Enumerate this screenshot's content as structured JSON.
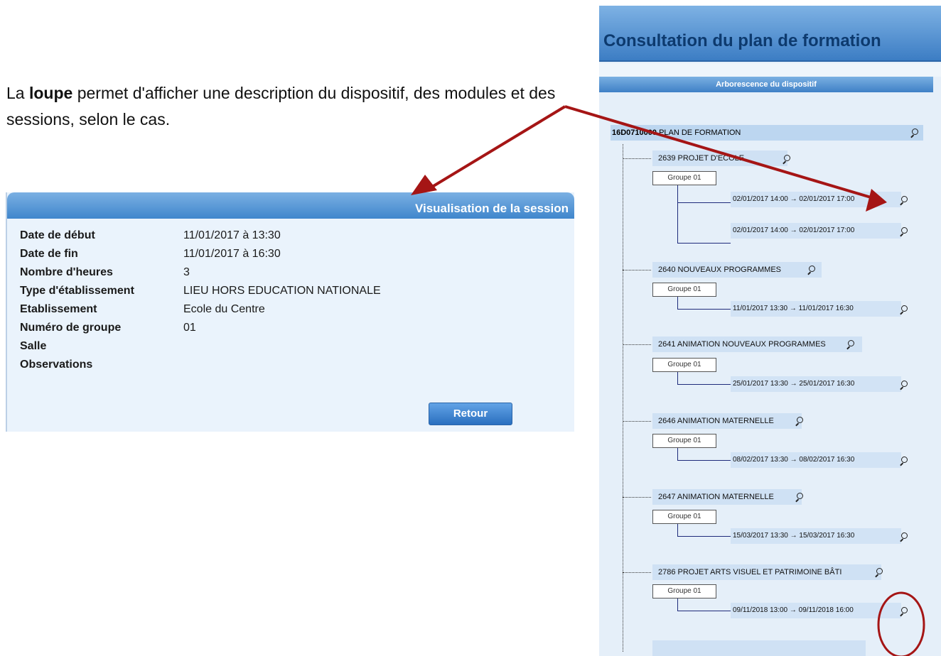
{
  "intro": {
    "prefix": "La ",
    "bold": "loupe",
    "suffix": " permet d'afficher une description du dispositif, des modules et des sessions, selon le cas."
  },
  "session": {
    "header_title": "Visualisation de la session",
    "rows": [
      {
        "label": "Date de début",
        "value": "11/01/2017 à 13:30"
      },
      {
        "label": "Date de fin",
        "value": "11/01/2017 à 16:30"
      },
      {
        "label": "Nombre d'heures",
        "value": "3"
      },
      {
        "label": "Type d'établissement",
        "value": "LIEU HORS EDUCATION NATIONALE"
      },
      {
        "label": "Etablissement",
        "value": "Ecole du Centre"
      },
      {
        "label": "Numéro de groupe",
        "value": "01"
      },
      {
        "label": "Salle",
        "value": ""
      },
      {
        "label": "Observations",
        "value": ""
      }
    ],
    "retour_label": "Retour"
  },
  "plan": {
    "title": "Consultation du plan de formation",
    "arbo_title": "Arborescence du dispositif",
    "root_code": "16D0710000",
    "root_label": " PLAN DE FORMATION",
    "dispositifs": [
      {
        "label": "2639 PROJET D'ECOLE",
        "groupe": "Groupe 01",
        "sessions": [
          "02/01/2017 14:00 → 02/01/2017 17:00",
          "02/01/2017 14:00 → 02/01/2017 17:00"
        ]
      },
      {
        "label": "2640 NOUVEAUX PROGRAMMES",
        "groupe": "Groupe 01",
        "sessions": [
          "11/01/2017 13:30 → 11/01/2017 16:30"
        ]
      },
      {
        "label": "2641 ANIMATION NOUVEAUX PROGRAMMES",
        "groupe": "Groupe 01",
        "sessions": [
          "25/01/2017 13:30 → 25/01/2017 16:30"
        ]
      },
      {
        "label": "2646 ANIMATION MATERNELLE",
        "groupe": "Groupe 01",
        "sessions": [
          "08/02/2017 13:30 → 08/02/2017 16:30"
        ]
      },
      {
        "label": "2647 ANIMATION MATERNELLE",
        "groupe": "Groupe 01",
        "sessions": [
          "15/03/2017 13:30 → 15/03/2017 16:30"
        ]
      },
      {
        "label": "2786 PROJET ARTS VISUEL ET PATRIMOINE BÂTI",
        "groupe": "Groupe 01",
        "sessions": [
          "09/11/2018 13:00 → 09/11/2018 16:00"
        ]
      }
    ]
  },
  "colors": {
    "header_blue": "#3f86cc",
    "panel_bg": "#eaf3fc",
    "arrow_red": "#a51515",
    "title_dark_blue": "#0d3a6e"
  }
}
